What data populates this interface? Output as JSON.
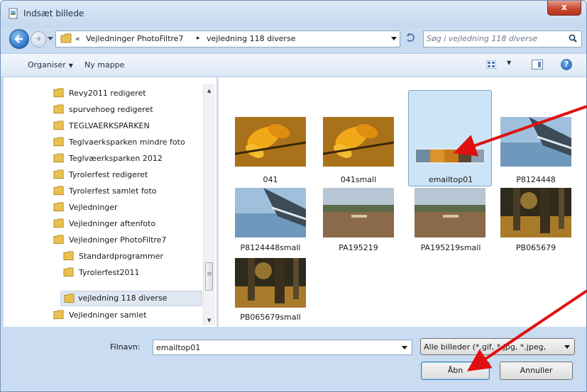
{
  "window": {
    "title": "Indsæt billede",
    "close_glyph": "x"
  },
  "address": {
    "overflow": "«",
    "crumbs": [
      "Vejledninger PhotoFiltre7",
      "vejledning 118 diverse"
    ],
    "separator": "▸"
  },
  "search": {
    "placeholder": "Søg i vejledning 118 diverse"
  },
  "toolbar": {
    "organize_label": "Organiser",
    "new_folder_label": "Ny mappe",
    "help_glyph": "?"
  },
  "tree": {
    "items": [
      {
        "label": "Revy2011 redigeret"
      },
      {
        "label": "spurvehoeg redigeret"
      },
      {
        "label": "TEGLVAERKSPARKEN"
      },
      {
        "label": "Teglvaerksparken mindre foto"
      },
      {
        "label": "Teglvæerksparken 2012"
      },
      {
        "label": "Tyrolerfest redigeret"
      },
      {
        "label": "Tyrolerfest samlet foto"
      },
      {
        "label": "Vejledninger"
      },
      {
        "label": "Vejledninger aftenfoto"
      },
      {
        "label": "Vejledninger PhotoFiltre7"
      },
      {
        "label": "Standardprogrammer"
      },
      {
        "label": "Tyrolerfest2011"
      },
      {
        "label": "vejledning 118 diverse"
      },
      {
        "label": "Vejledninger samlet"
      }
    ]
  },
  "files": {
    "items": [
      {
        "name": "041",
        "image": "autumn-leaves"
      },
      {
        "name": "041small",
        "image": "autumn-leaves"
      },
      {
        "name": "emailtop01",
        "image": "email-banner"
      },
      {
        "name": "P8124448",
        "image": "lake-bridge"
      },
      {
        "name": "P8124448small",
        "image": "lake-bridge"
      },
      {
        "name": "PA195219",
        "image": "marsh"
      },
      {
        "name": "PA195219small",
        "image": "marsh"
      },
      {
        "name": "PB065679",
        "image": "forest"
      },
      {
        "name": "PB065679small",
        "image": "forest"
      }
    ]
  },
  "bottom": {
    "filename_label": "Filnavn:",
    "filename_value": "emailtop01",
    "filter_label": "Alle billeder (*.gif, *.jpg, *.jpeg,",
    "open_label": "Åbn",
    "cancel_label": "Annuller"
  },
  "colors": {
    "annotation_arrow": "#e01010",
    "folder": "#e8c251",
    "selection": "#cce4f7"
  }
}
